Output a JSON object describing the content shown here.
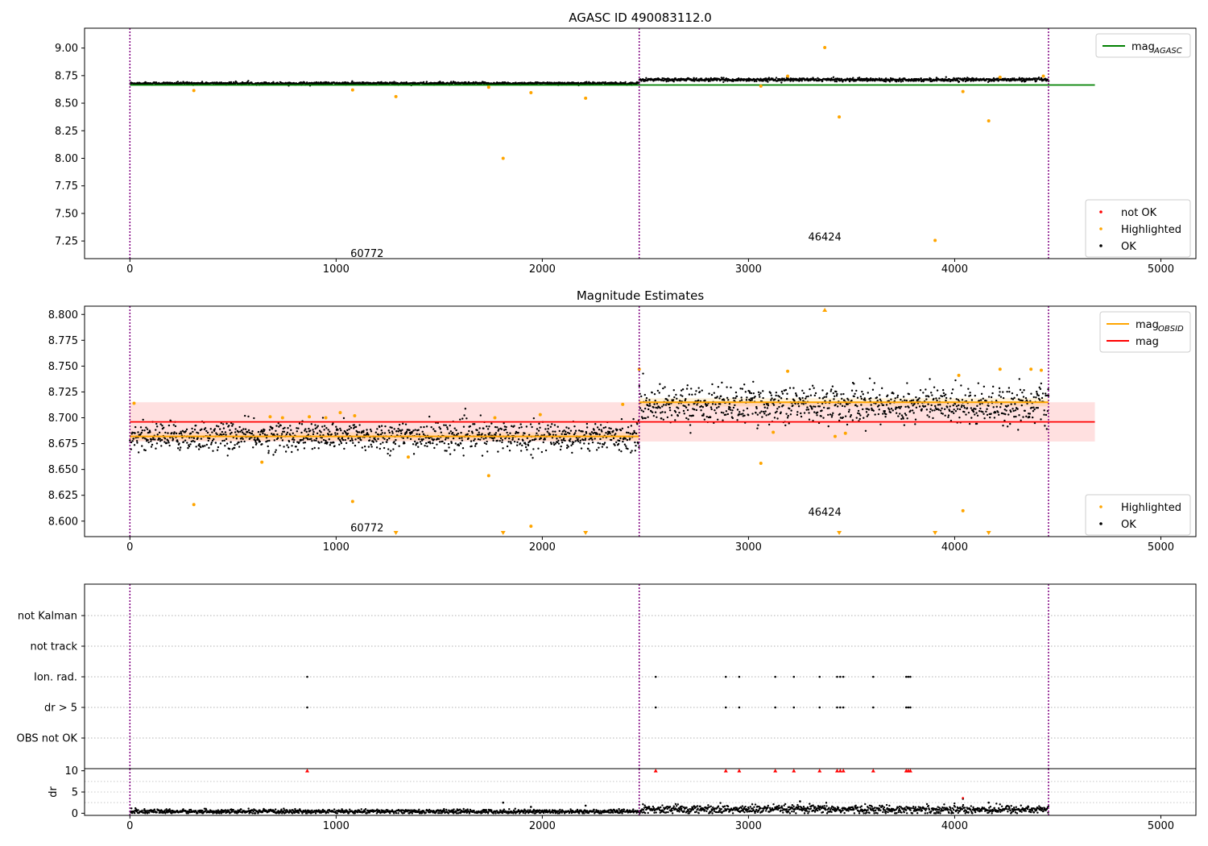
{
  "chart_data": [
    {
      "type": "scatter",
      "title": "AGASC ID 490083112.0",
      "xlim": [
        -220,
        5170
      ],
      "ylim": [
        7.09,
        9.18
      ],
      "xticks": [
        0,
        1000,
        2000,
        3000,
        4000,
        5000
      ],
      "yticks": [
        "7.25",
        "7.50",
        "7.75",
        "8.00",
        "8.25",
        "8.50",
        "8.75",
        "9.00"
      ],
      "obsid_boundaries": [
        0,
        2470,
        4455
      ],
      "obsid_labels": [
        {
          "text": "60772",
          "x": 1150,
          "y": 7.14
        },
        {
          "text": "46424",
          "x": 3370,
          "y": 7.29
        }
      ],
      "mag_agasc": {
        "value": 8.665,
        "x_range": [
          0,
          4680
        ],
        "color": "#008000"
      },
      "ok_series": [
        {
          "x_range": [
            0,
            2470
          ],
          "center": 8.679,
          "spread": 0.006
        },
        {
          "x_range": [
            2470,
            4455
          ],
          "center": 8.713,
          "spread": 0.007
        }
      ],
      "highlighted": [
        [
          310,
          8.615
        ],
        [
          1080,
          8.62
        ],
        [
          1290,
          8.56
        ],
        [
          1740,
          8.645
        ],
        [
          1810,
          8.0
        ],
        [
          1945,
          8.595
        ],
        [
          2210,
          8.545
        ],
        [
          3060,
          8.655
        ],
        [
          3190,
          8.745
        ],
        [
          3370,
          9.005
        ],
        [
          3440,
          8.375
        ],
        [
          3905,
          7.255
        ],
        [
          4040,
          8.605
        ],
        [
          4165,
          8.34
        ],
        [
          4220,
          8.735
        ],
        [
          4430,
          8.745
        ]
      ],
      "legend_upper": [
        {
          "label": "mag",
          "sub": "AGASC",
          "color": "#008000",
          "kind": "line"
        }
      ],
      "legend_lower": [
        {
          "label": "not OK",
          "color": "#ff0000",
          "kind": "point"
        },
        {
          "label": "Highlighted",
          "color": "#ffa500",
          "kind": "point"
        },
        {
          "label": "OK",
          "color": "#000000",
          "kind": "point"
        }
      ]
    },
    {
      "type": "scatter",
      "title": "Magnitude Estimates",
      "xlim": [
        -220,
        5170
      ],
      "ylim": [
        8.585,
        8.808
      ],
      "xticks": [
        0,
        1000,
        2000,
        3000,
        4000,
        5000
      ],
      "yticks": [
        "8.600",
        "8.625",
        "8.650",
        "8.675",
        "8.700",
        "8.725",
        "8.750",
        "8.775",
        "8.800"
      ],
      "obsid_boundaries": [
        0,
        2470,
        4455
      ],
      "obsid_labels": [
        {
          "text": "60772",
          "x": 1150,
          "y": 8.594
        },
        {
          "text": "46424",
          "x": 3370,
          "y": 8.609
        }
      ],
      "mag": {
        "value": 8.696,
        "band": [
          8.677,
          8.715
        ],
        "x_range": [
          0,
          4680
        ],
        "color": "#ff0000"
      },
      "mag_obsid": [
        {
          "value": 8.682,
          "x_range": [
            0,
            2470
          ]
        },
        {
          "value": 8.715,
          "x_range": [
            2470,
            4455
          ]
        }
      ],
      "ok_series": [
        {
          "x_range": [
            0,
            2470
          ],
          "center": 8.682,
          "spread": 0.007
        },
        {
          "x_range": [
            2470,
            4455
          ],
          "center": 8.713,
          "spread": 0.009
        }
      ],
      "highlighted": [
        [
          20,
          8.714
        ],
        [
          310,
          8.616
        ],
        [
          640,
          8.657
        ],
        [
          680,
          8.701
        ],
        [
          740,
          8.7
        ],
        [
          870,
          8.701
        ],
        [
          950,
          8.7
        ],
        [
          1020,
          8.705
        ],
        [
          1080,
          8.619
        ],
        [
          1090,
          8.702
        ],
        [
          1350,
          8.662
        ],
        [
          1740,
          8.644
        ],
        [
          1770,
          8.7
        ],
        [
          1945,
          8.595
        ],
        [
          1990,
          8.703
        ],
        [
          2390,
          8.713
        ],
        [
          2470,
          8.747
        ],
        [
          3060,
          8.656
        ],
        [
          3120,
          8.686
        ],
        [
          3190,
          8.745
        ],
        [
          3420,
          8.682
        ],
        [
          3470,
          8.685
        ],
        [
          4020,
          8.741
        ],
        [
          4040,
          8.61
        ],
        [
          4220,
          8.747
        ],
        [
          4370,
          8.747
        ],
        [
          4420,
          8.746
        ]
      ],
      "offscale_markers": [
        [
          1290,
          "down"
        ],
        [
          1810,
          "down"
        ],
        [
          2210,
          "down"
        ],
        [
          3370,
          "up"
        ],
        [
          3440,
          "down"
        ],
        [
          3905,
          "down"
        ],
        [
          4165,
          "down"
        ]
      ],
      "legend_upper": [
        {
          "label": "mag",
          "sub": "OBSID",
          "color": "#ffa500",
          "kind": "line"
        },
        {
          "label": "mag",
          "sub": "",
          "color": "#ff0000",
          "kind": "line"
        }
      ],
      "legend_lower": [
        {
          "label": "Highlighted",
          "color": "#ffa500",
          "kind": "point"
        },
        {
          "label": "OK",
          "color": "#000000",
          "kind": "point"
        }
      ]
    },
    {
      "type": "scatter",
      "xlim": [
        -220,
        5170
      ],
      "categories": [
        "not Kalman",
        "not track",
        "Ion. rad.",
        "dr > 5",
        "OBS not OK"
      ],
      "obsid_boundaries": [
        0,
        2470,
        4455
      ],
      "flag_points": {
        "Ion. rad.": [
          860,
          2550,
          2890,
          2955,
          3130,
          3220,
          3345,
          3430,
          3445,
          3460,
          3605,
          3765,
          3775,
          3785
        ],
        "dr > 5": [
          860,
          2550,
          2890,
          2955,
          3130,
          3220,
          3345,
          3430,
          3445,
          3460,
          3605,
          3765,
          3775,
          3785
        ]
      }
    },
    {
      "type": "scatter",
      "ylabel": "dr",
      "xlim": [
        -220,
        5170
      ],
      "ylim": [
        -0.5,
        10.5
      ],
      "xticks": [
        0,
        1000,
        2000,
        3000,
        4000,
        5000
      ],
      "yticks": [
        "0",
        "5",
        "10"
      ],
      "obsid_boundaries": [
        0,
        2470,
        4455
      ],
      "capped_at": 10,
      "capped_points": [
        860,
        2550,
        2890,
        2955,
        3130,
        3220,
        3345,
        3430,
        3445,
        3460,
        3605,
        3765,
        3775,
        3785
      ],
      "ok_series": [
        {
          "x_range": [
            0,
            2470
          ],
          "center": 0.4,
          "spread": 0.25
        },
        {
          "x_range": [
            2470,
            4455
          ],
          "center": 0.9,
          "spread": 0.5
        }
      ],
      "outliers": [
        [
          1810,
          2.5
        ],
        [
          1945,
          1.5
        ],
        [
          2210,
          1.8
        ],
        [
          3250,
          2.8
        ],
        [
          4040,
          3.4
        ],
        [
          4165,
          2.5
        ]
      ]
    }
  ]
}
